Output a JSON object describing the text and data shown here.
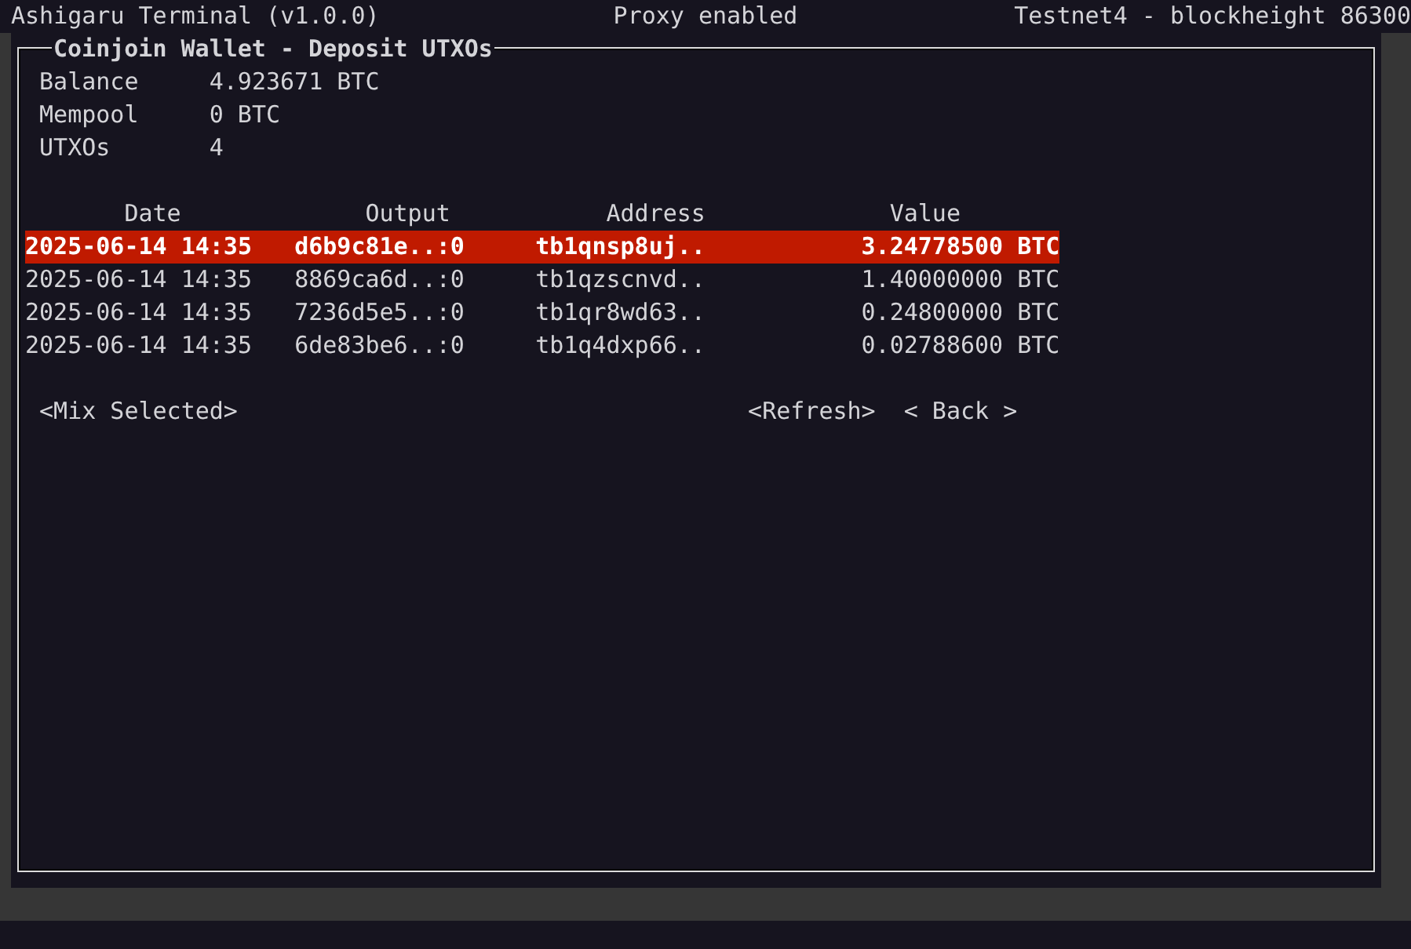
{
  "status_bar": {
    "app": "Ashigaru Terminal (v1.0.0)",
    "proxy": "Proxy enabled",
    "network": "Testnet4 - blockheight 86300"
  },
  "panel": {
    "title": "Coinjoin Wallet - Deposit UTXOs",
    "summary": [
      {
        "label": "Balance",
        "value": "4.923671 BTC"
      },
      {
        "label": "Mempool",
        "value": "0 BTC"
      },
      {
        "label": "UTXOs",
        "value": "4"
      }
    ],
    "table": {
      "columns": [
        "Date",
        "Output",
        "Address",
        "Value"
      ],
      "rows": [
        {
          "date": "2025-06-14 14:35",
          "output": "d6b9c81e..:0",
          "address": "tb1qnsp8uj..",
          "value": "3.24778500 BTC",
          "selected": true
        },
        {
          "date": "2025-06-14 14:35",
          "output": "8869ca6d..:0",
          "address": "tb1qzscnvd..",
          "value": "1.40000000 BTC",
          "selected": false
        },
        {
          "date": "2025-06-14 14:35",
          "output": "7236d5e5..:0",
          "address": "tb1qr8wd63..",
          "value": "0.24800000 BTC",
          "selected": false
        },
        {
          "date": "2025-06-14 14:35",
          "output": "6de83be6..:0",
          "address": "tb1q4dxp66..",
          "value": "0.02788600 BTC",
          "selected": false
        }
      ]
    },
    "buttons": [
      "<Mix Selected>",
      "<Refresh>",
      "< Back >"
    ]
  }
}
